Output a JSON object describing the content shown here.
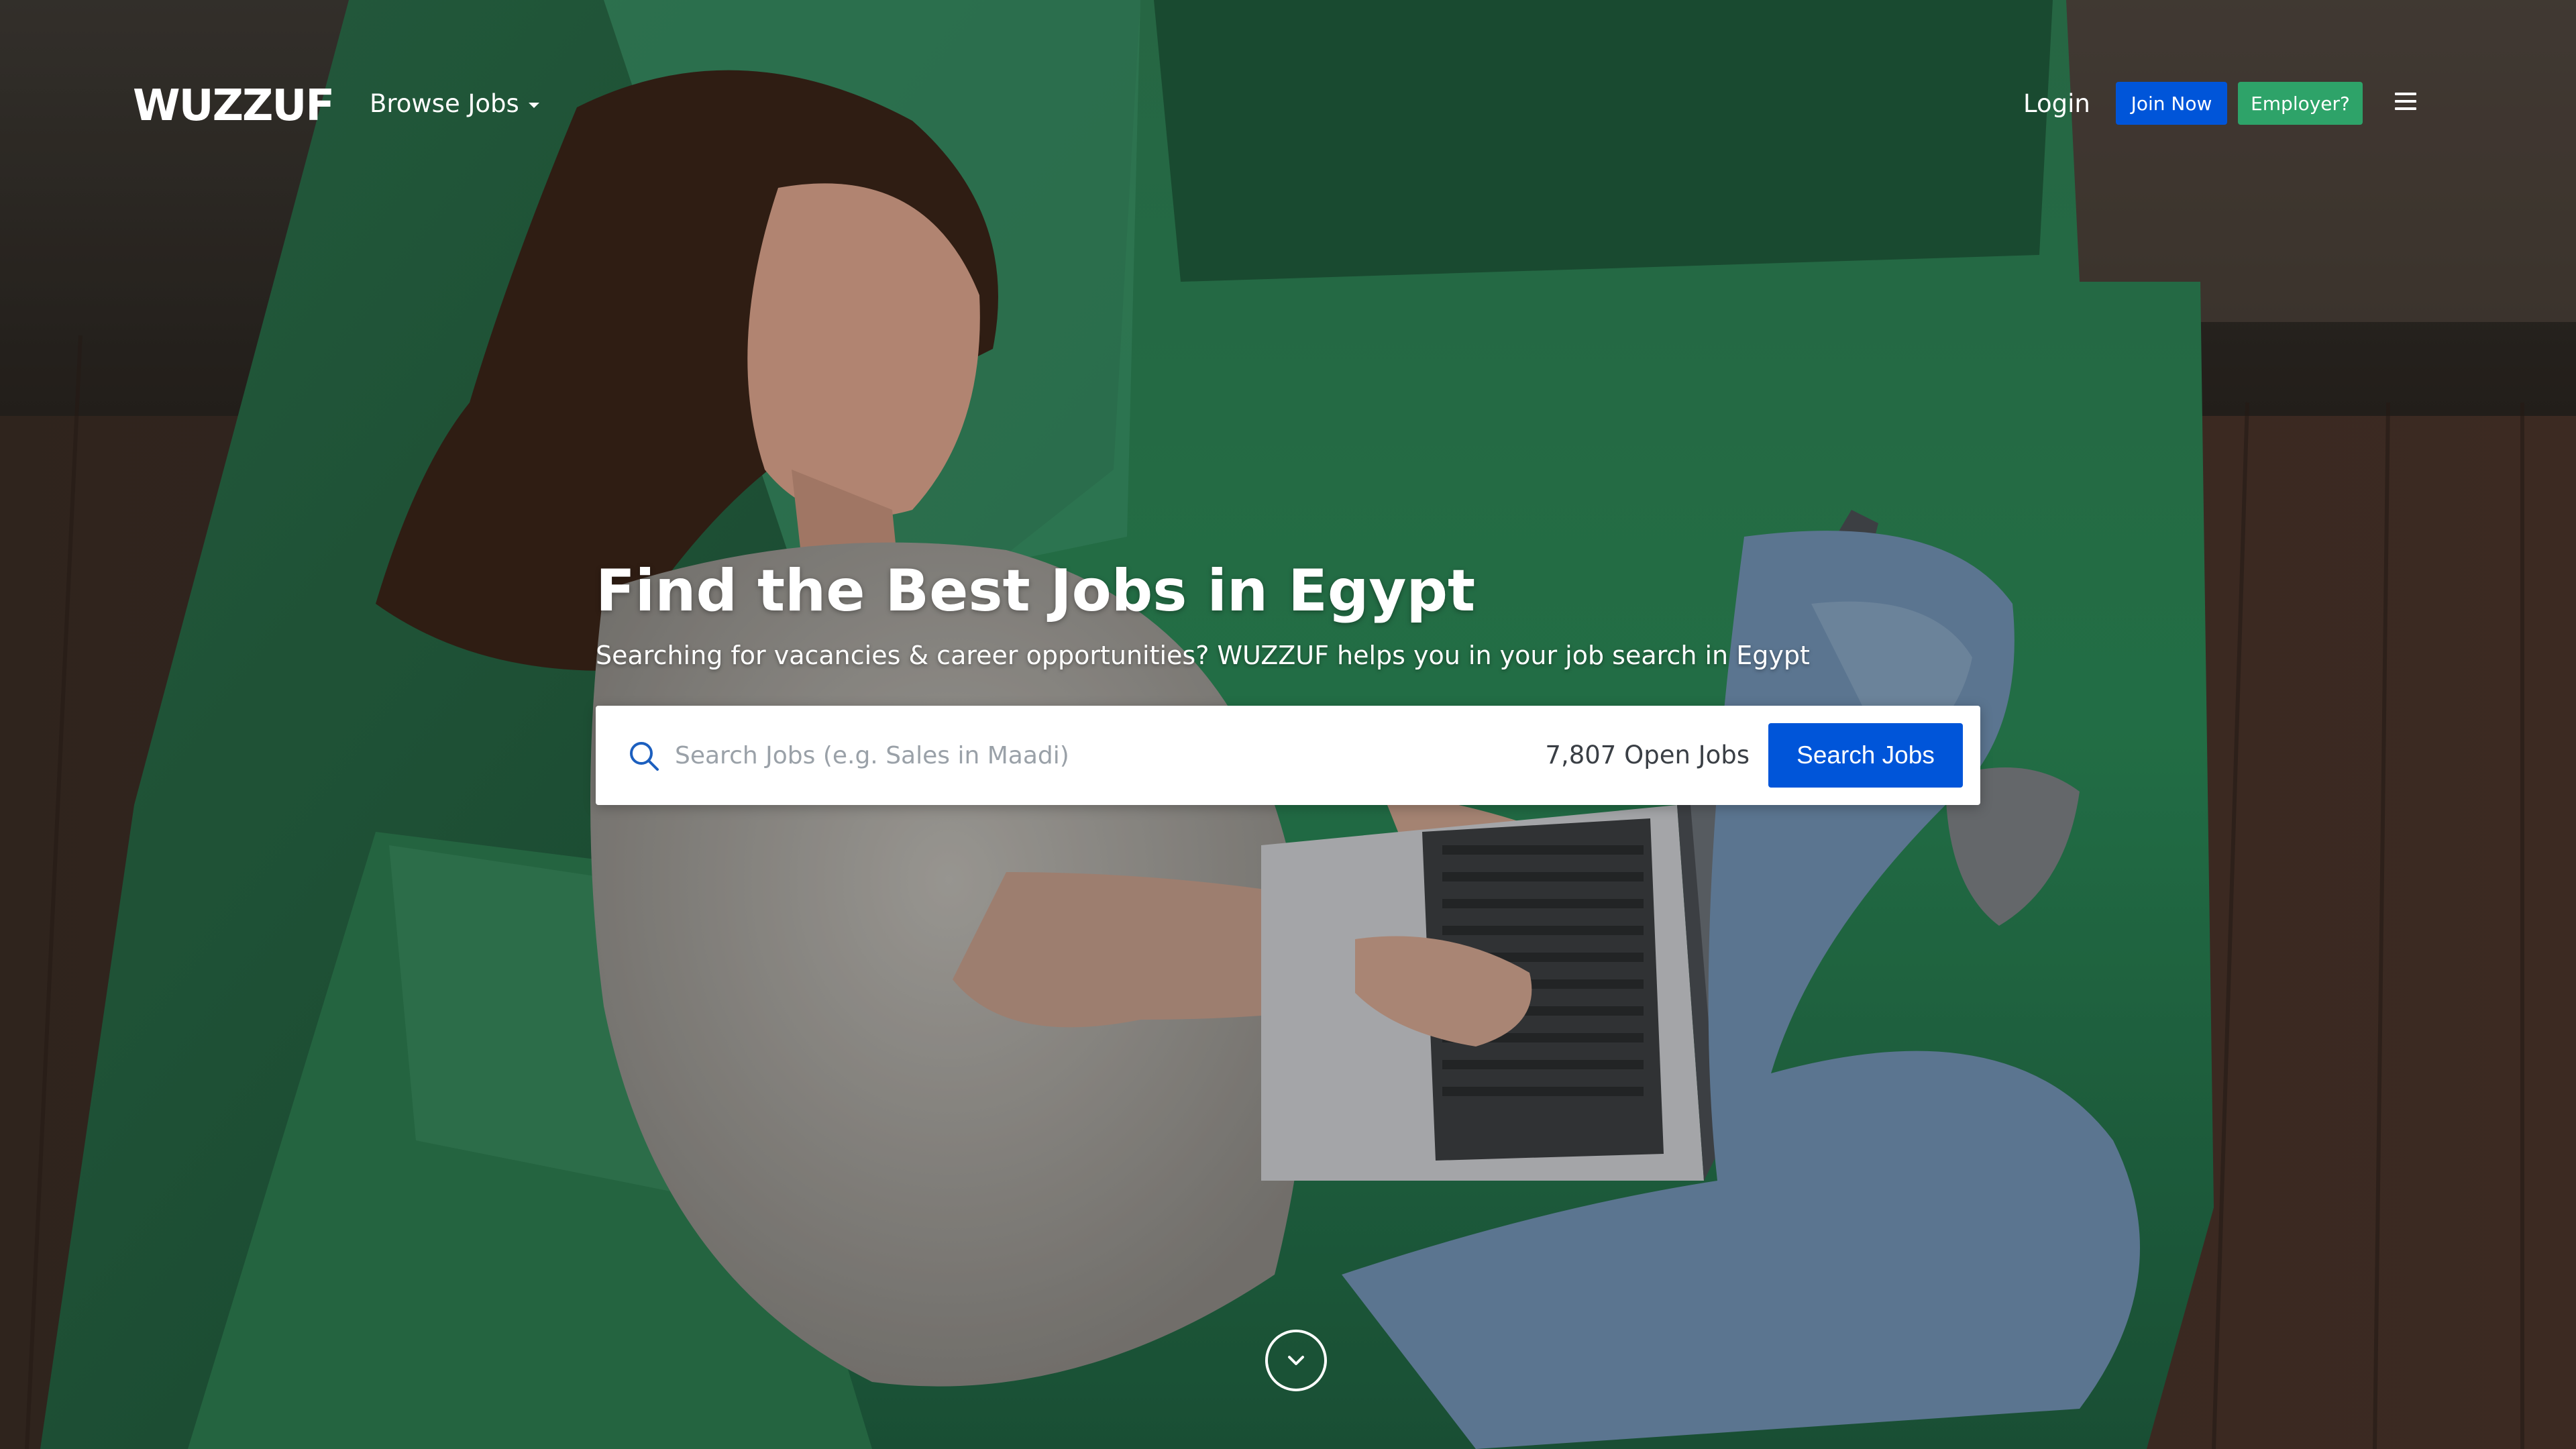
{
  "brand": {
    "logo_text": "WUZZUF"
  },
  "nav": {
    "browse_jobs_label": "Browse Jobs",
    "login_label": "Login",
    "join_label": "Join Now",
    "employer_label": "Employer?",
    "menu_icon": "hamburger-menu-icon"
  },
  "hero": {
    "title": "Find the Best Jobs in Egypt",
    "subtitle": "Searching for vacancies & career opportunities? WUZZUF helps you in your job search in Egypt"
  },
  "search": {
    "placeholder": "Search Jobs (e.g. Sales in Maadi)",
    "value": "",
    "open_jobs_text": "7,807 Open Jobs",
    "button_label": "Search Jobs",
    "icon": "search-icon"
  },
  "scroll": {
    "icon": "chevron-down-icon"
  },
  "colors": {
    "primary_blue": "#0055d9",
    "employer_green": "#2ea369",
    "text_white": "#ffffff"
  }
}
